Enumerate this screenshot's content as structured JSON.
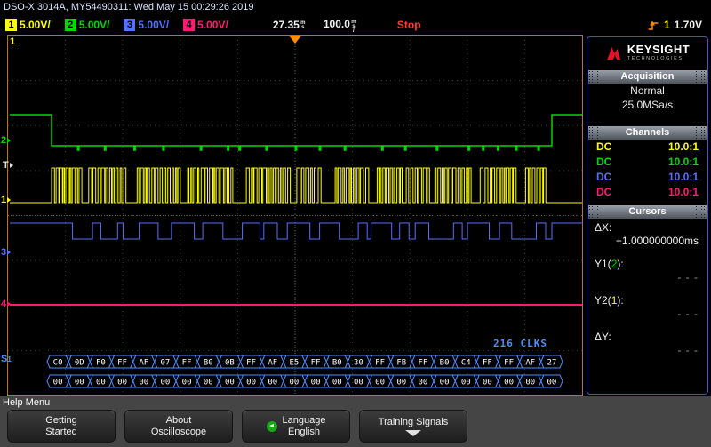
{
  "colors": {
    "ch1": "#ffff00",
    "ch2": "#00d800",
    "ch3": "#5570ff",
    "ch4": "#ff1a75",
    "bus": "#4d8eff",
    "stop": "#ff3b30",
    "trigger": "#ff8c00",
    "brand": "#e8112d"
  },
  "title_bar": {
    "text": "DSO-X 3014A, MY54490311: Wed May 15 00:29:26 2019"
  },
  "settings_bar": {
    "channels": [
      {
        "num": "1",
        "scale": "5.00V/"
      },
      {
        "num": "2",
        "scale": "5.00V/"
      },
      {
        "num": "3",
        "scale": "5.00V/"
      },
      {
        "num": "4",
        "scale": "5.00V/"
      }
    ],
    "delay": {
      "value": "27.35",
      "unit": "ms"
    },
    "timebase": {
      "value": "100.0",
      "unit": "ms/"
    },
    "run_state": "Stop",
    "trigger": {
      "edge_icon": "rising-edge",
      "source": "1",
      "level": "1.70V"
    }
  },
  "scope": {
    "clks_label": "216 CLKS",
    "markers": {
      "ch1_top": "1",
      "ch2": "2",
      "trigger": "T",
      "ch1": "1",
      "ch3": "3",
      "ch4": "4",
      "bus": "S",
      "bus_sub": "1"
    },
    "bus_rows": [
      {
        "bytes": [
          "C0",
          "0D",
          "F0",
          "FF",
          "AF",
          "07",
          "FF",
          "B0",
          "0B",
          "FF",
          "AF",
          "E5",
          "FF",
          "B0",
          "30",
          "FF",
          "FB",
          "FF",
          "B0",
          "C4",
          "FF",
          "FF",
          "AF",
          "27"
        ]
      },
      {
        "bytes": [
          "00",
          "00",
          "00",
          "00",
          "00",
          "00",
          "00",
          "00",
          "00",
          "00",
          "00",
          "00",
          "00",
          "00",
          "00",
          "00",
          "00",
          "00",
          "00",
          "00",
          "00",
          "00",
          "00",
          "00"
        ]
      }
    ]
  },
  "sidebar": {
    "brand": {
      "name": "KEYSIGHT",
      "sub": "TECHNOLOGIES"
    },
    "acquisition": {
      "title": "Acquisition",
      "mode": "Normal",
      "sample_rate": "25.0MSa/s"
    },
    "channels": {
      "title": "Channels",
      "rows": [
        {
          "coupling": "DC",
          "probe": "10.0:1"
        },
        {
          "coupling": "DC",
          "probe": "10.0:1"
        },
        {
          "coupling": "DC",
          "probe": "10.0:1"
        },
        {
          "coupling": "DC",
          "probe": "10.0:1"
        }
      ]
    },
    "cursors": {
      "title": "Cursors",
      "dx": {
        "label": "ΔX:",
        "value": "+1.000000000ms"
      },
      "y1": {
        "pre": "Y1(",
        "ch": "2",
        "post": "):",
        "value": "- - -"
      },
      "y2": {
        "pre": "Y2(",
        "ch": "1",
        "post": "):",
        "value": "- - -"
      },
      "dy": {
        "label": "ΔY:",
        "value": "- - -"
      }
    }
  },
  "help_menu": {
    "title": "Help Menu",
    "softkeys": [
      {
        "line1": "Getting",
        "line2": "Started",
        "icon": ""
      },
      {
        "line1": "About",
        "line2": "Oscilloscope",
        "icon": ""
      },
      {
        "line1": "Language",
        "line2": "English",
        "icon": "back-circle"
      },
      {
        "line1": "Training Signals",
        "line2": "",
        "icon": "down-arrow"
      }
    ]
  }
}
